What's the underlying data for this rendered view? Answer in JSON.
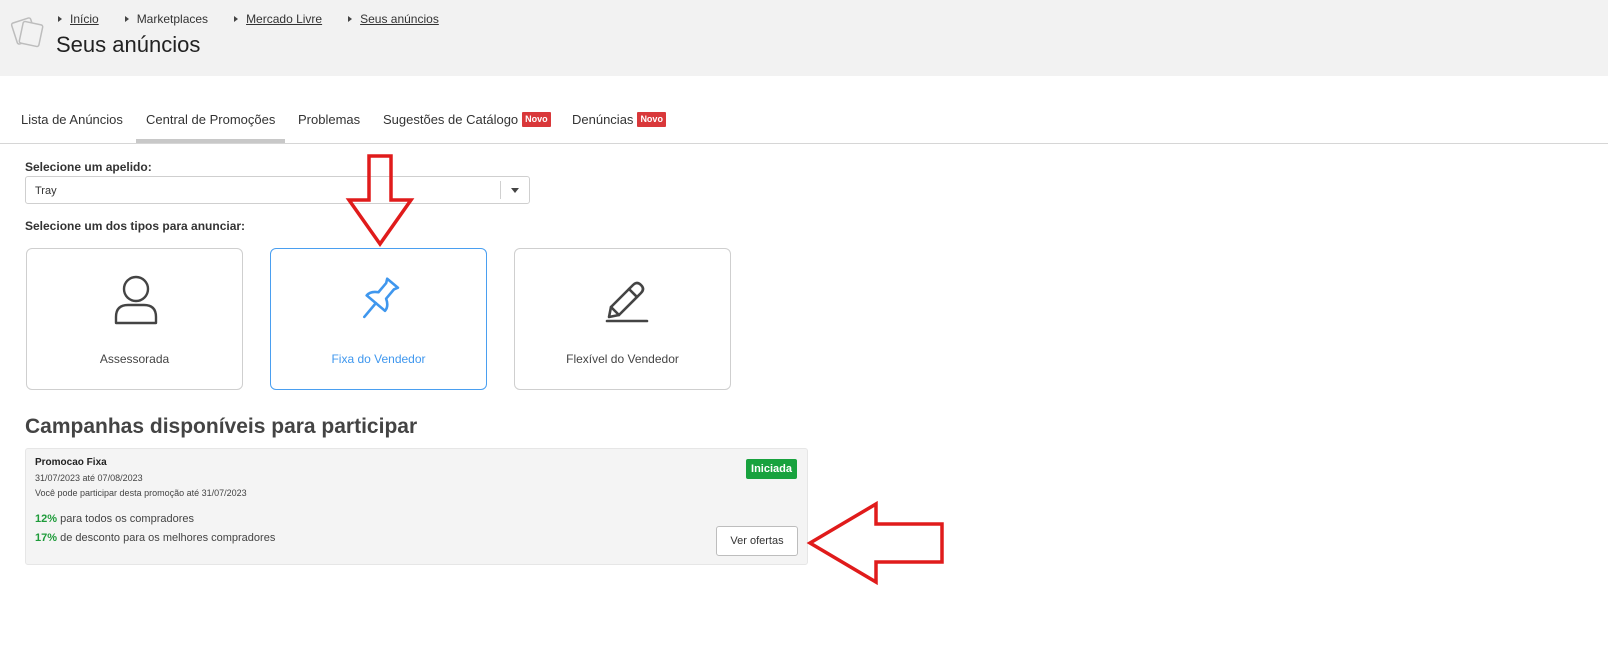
{
  "breadcrumb": [
    {
      "label": "Início",
      "link": true
    },
    {
      "label": "Marketplaces",
      "link": false
    },
    {
      "label": "Mercado Livre",
      "link": true
    },
    {
      "label": "Seus anúncios",
      "link": true
    }
  ],
  "page_title": "Seus anúncios",
  "tabs": [
    {
      "label": "Lista de Anúncios"
    },
    {
      "label": "Central de Promoções",
      "active": true
    },
    {
      "label": "Problemas"
    },
    {
      "label": "Sugestões de Catálogo",
      "badge": "Novo"
    },
    {
      "label": "Denúncias",
      "badge": "Novo"
    }
  ],
  "nickname": {
    "label": "Selecione um apelido:",
    "value": "Tray"
  },
  "types": {
    "label": "Selecione um dos tipos para anunciar:",
    "options": [
      {
        "label": "Assessorada",
        "icon": "user-icon"
      },
      {
        "label": "Fixa do Vendedor",
        "icon": "pushpin-icon",
        "selected": true
      },
      {
        "label": "Flexível do Vendedor",
        "icon": "pencil-icon"
      }
    ]
  },
  "campaigns": {
    "title": "Campanhas disponíveis para participar",
    "items": [
      {
        "name": "Promocao Fixa",
        "dates": "31/07/2023 até 07/08/2023",
        "deadline": "Você pode participar desta promoção até 31/07/2023",
        "status": "Iniciada",
        "discount_all_pct": "12%",
        "discount_all_text": " para todos os compradores",
        "discount_best_pct": "17%",
        "discount_best_text": " de desconto para os melhores compradores",
        "button_label": "Ver ofertas"
      }
    ]
  },
  "colors": {
    "accent_blue": "#3f97ee",
    "status_green": "#18a23e",
    "badge_red": "#d9383a",
    "annotation_red": "#e01b1b"
  }
}
